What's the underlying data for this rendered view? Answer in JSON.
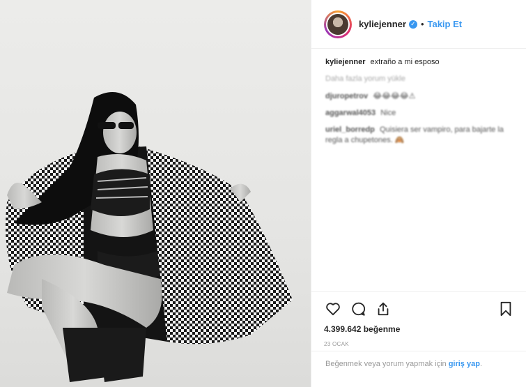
{
  "header": {
    "username": "kyliejenner",
    "separator": "•",
    "follow_label": "Takip Et"
  },
  "comments": [
    {
      "author": "kyliejenner",
      "text": "extraño a mi esposo",
      "blurred": false
    },
    {
      "author": "",
      "text": "Daha fazla yorum yükle",
      "type": "load_more"
    },
    {
      "author": "djuropetrov",
      "text": "😂😂😂😂⚠",
      "blurred": true
    },
    {
      "author": "aggarwal4053",
      "text": "Nice",
      "blurred": true
    },
    {
      "author": "uriel_borredp",
      "text": "Quisiera ser vampiro, para bajarte la regla a chupetones. 🙈",
      "blurred": true
    }
  ],
  "actions": {
    "like_icon": "heart-icon",
    "comment_icon": "comment-icon",
    "share_icon": "share-icon",
    "save_icon": "bookmark-icon"
  },
  "likes": "4.399.642 beğenme",
  "date": "23 OCAK",
  "login": {
    "prefix": "Beğenmek veya yorum yapmak için ",
    "link": "giriş yap",
    "suffix": "."
  },
  "colors": {
    "accent": "#3897f0",
    "text": "#262626",
    "muted": "#999999",
    "border": "#efefef"
  }
}
